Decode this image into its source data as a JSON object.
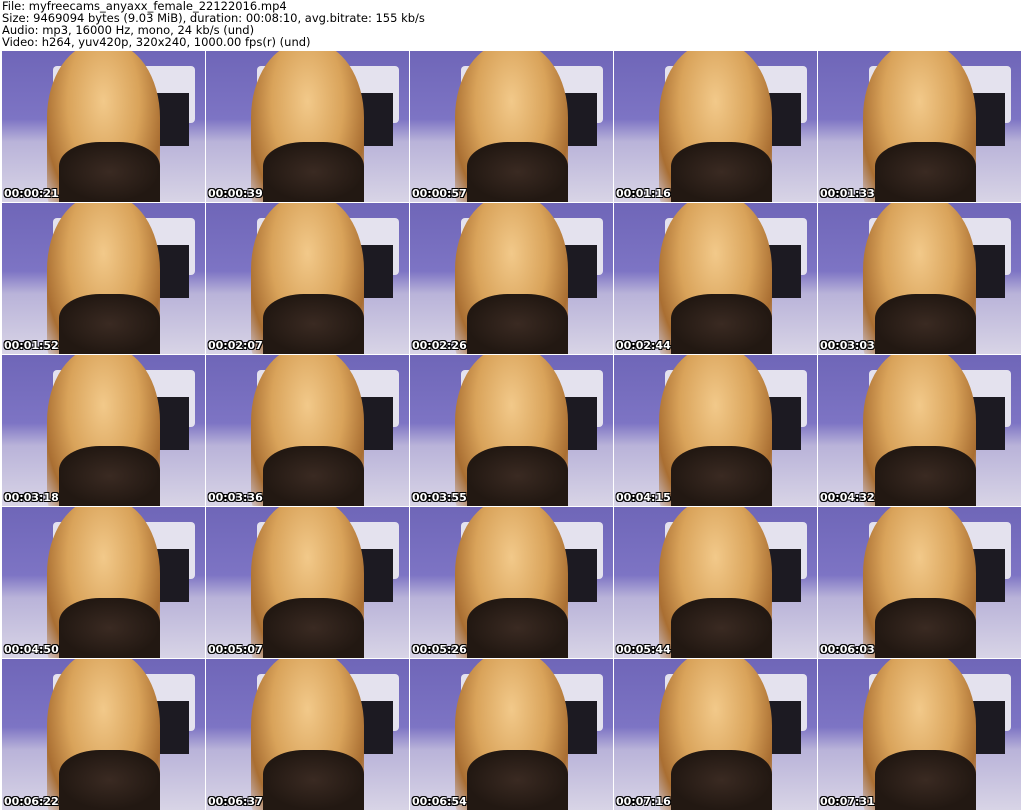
{
  "header": {
    "file": "File: myfreecams_anyaxx_female_22122016.mp4",
    "size": "Size: 9469094 bytes (9.03 MiB), duration: 00:08:10, avg.bitrate: 155 kb/s",
    "audio": "Audio: mp3, 16000 Hz, mono, 24 kb/s (und)",
    "video": "Video: h264, yuv420p, 320x240, 1000.00 fps(r) (und)"
  },
  "thumbnails": [
    {
      "time": "00:00:21"
    },
    {
      "time": "00:00:39"
    },
    {
      "time": "00:00:57"
    },
    {
      "time": "00:01:16"
    },
    {
      "time": "00:01:33"
    },
    {
      "time": "00:01:52"
    },
    {
      "time": "00:02:07"
    },
    {
      "time": "00:02:26"
    },
    {
      "time": "00:02:44"
    },
    {
      "time": "00:03:03"
    },
    {
      "time": "00:03:18"
    },
    {
      "time": "00:03:36"
    },
    {
      "time": "00:03:55"
    },
    {
      "time": "00:04:15"
    },
    {
      "time": "00:04:32"
    },
    {
      "time": "00:04:50"
    },
    {
      "time": "00:05:07"
    },
    {
      "time": "00:05:26"
    },
    {
      "time": "00:05:44"
    },
    {
      "time": "00:06:03"
    },
    {
      "time": "00:06:22"
    },
    {
      "time": "00:06:37"
    },
    {
      "time": "00:06:54"
    },
    {
      "time": "00:07:16"
    },
    {
      "time": "00:07:31"
    }
  ]
}
